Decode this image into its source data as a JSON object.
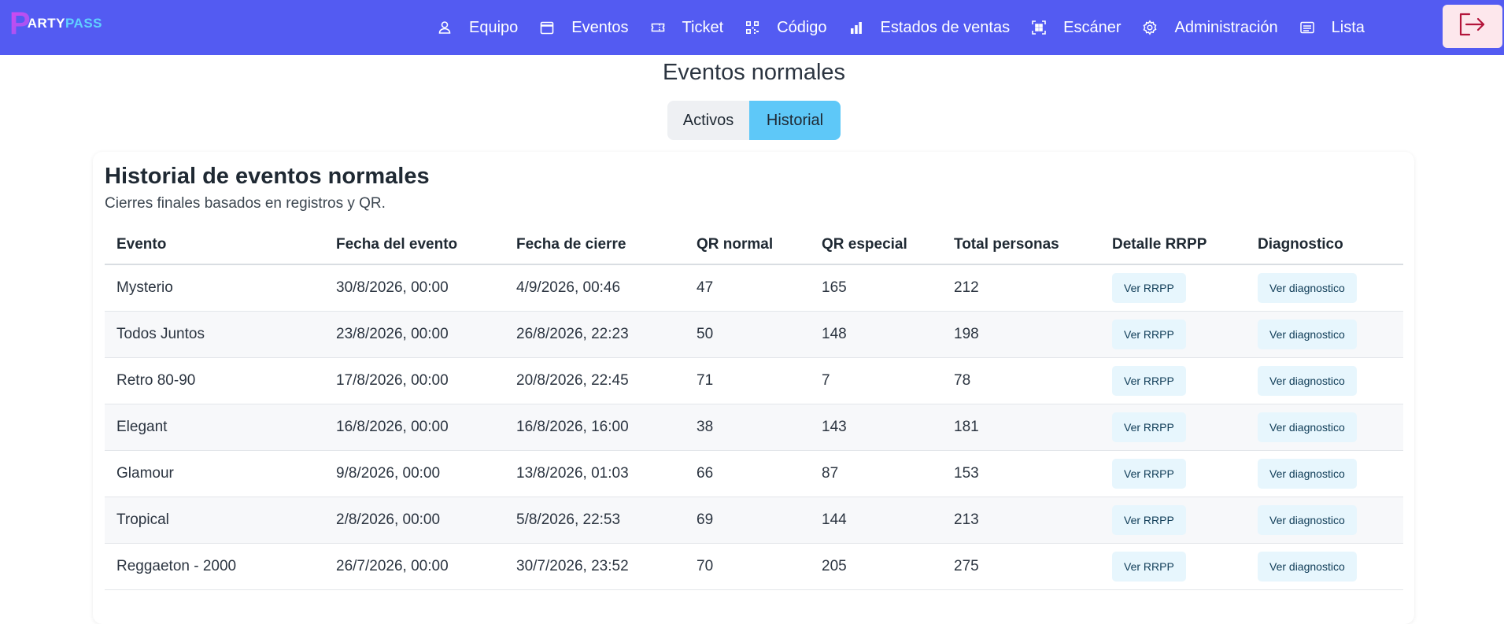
{
  "brand": {
    "p": "P",
    "text_main": "ARTY",
    "text_accent": "PASS"
  },
  "nav": {
    "items": [
      {
        "label": "Equipo",
        "icon": "user-icon"
      },
      {
        "label": "Eventos",
        "icon": "calendar-icon"
      },
      {
        "label": "Ticket",
        "icon": "ticket-icon"
      },
      {
        "label": "Código",
        "icon": "qr-code-icon"
      },
      {
        "label": "Estados de ventas",
        "icon": "bar-chart-icon"
      },
      {
        "label": "Escáner",
        "icon": "scan-icon"
      },
      {
        "label": "Administración",
        "icon": "gear-icon"
      },
      {
        "label": "Lista",
        "icon": "list-icon"
      }
    ],
    "logout_icon": "logout-icon"
  },
  "page": {
    "title": "Eventos normales",
    "tabs": [
      {
        "label": "Activos",
        "active": false
      },
      {
        "label": "Historial",
        "active": true
      }
    ]
  },
  "card": {
    "title": "Historial de eventos normales",
    "subtitle": "Cierres finales basados en registros y QR."
  },
  "table": {
    "headers": [
      "Evento",
      "Fecha del evento",
      "Fecha de cierre",
      "QR normal",
      "QR especial",
      "Total personas",
      "Detalle RRPP",
      "Diagnostico"
    ],
    "rows": [
      {
        "evento": "Mysterio",
        "fecha_evento": "30/8/2026, 00:00",
        "fecha_cierre": "4/9/2026, 00:46",
        "qr_normal": "47",
        "qr_especial": "165",
        "total": "212",
        "rrpp_btn": "Ver RRPP",
        "diag_btn": "Ver diagnostico"
      },
      {
        "evento": "Todos Juntos",
        "fecha_evento": "23/8/2026, 00:00",
        "fecha_cierre": "26/8/2026, 22:23",
        "qr_normal": "50",
        "qr_especial": "148",
        "total": "198",
        "rrpp_btn": "Ver RRPP",
        "diag_btn": "Ver diagnostico"
      },
      {
        "evento": "Retro 80-90",
        "fecha_evento": "17/8/2026, 00:00",
        "fecha_cierre": "20/8/2026, 22:45",
        "qr_normal": "71",
        "qr_especial": "7",
        "total": "78",
        "rrpp_btn": "Ver RRPP",
        "diag_btn": "Ver diagnostico"
      },
      {
        "evento": "Elegant",
        "fecha_evento": "16/8/2026, 00:00",
        "fecha_cierre": "16/8/2026, 16:00",
        "qr_normal": "38",
        "qr_especial": "143",
        "total": "181",
        "rrpp_btn": "Ver RRPP",
        "diag_btn": "Ver diagnostico"
      },
      {
        "evento": "Glamour",
        "fecha_evento": "9/8/2026, 00:00",
        "fecha_cierre": "13/8/2026, 01:03",
        "qr_normal": "66",
        "qr_especial": "87",
        "total": "153",
        "rrpp_btn": "Ver RRPP",
        "diag_btn": "Ver diagnostico"
      },
      {
        "evento": "Tropical",
        "fecha_evento": "2/8/2026, 00:00",
        "fecha_cierre": "5/8/2026, 22:53",
        "qr_normal": "69",
        "qr_especial": "144",
        "total": "213",
        "rrpp_btn": "Ver RRPP",
        "diag_btn": "Ver diagnostico"
      },
      {
        "evento": "Reggaeton - 2000",
        "fecha_evento": "26/7/2026, 00:00",
        "fecha_cierre": "30/7/2026, 23:52",
        "qr_normal": "70",
        "qr_especial": "205",
        "total": "275",
        "rrpp_btn": "Ver RRPP",
        "diag_btn": "Ver diagnostico"
      }
    ]
  },
  "colors": {
    "navbar": "#535bf2",
    "tab_active": "#5ec8f8",
    "logout_bg": "#fde7ec",
    "logout_icon": "#b3143a",
    "button_bg": "#e7f6fd"
  }
}
